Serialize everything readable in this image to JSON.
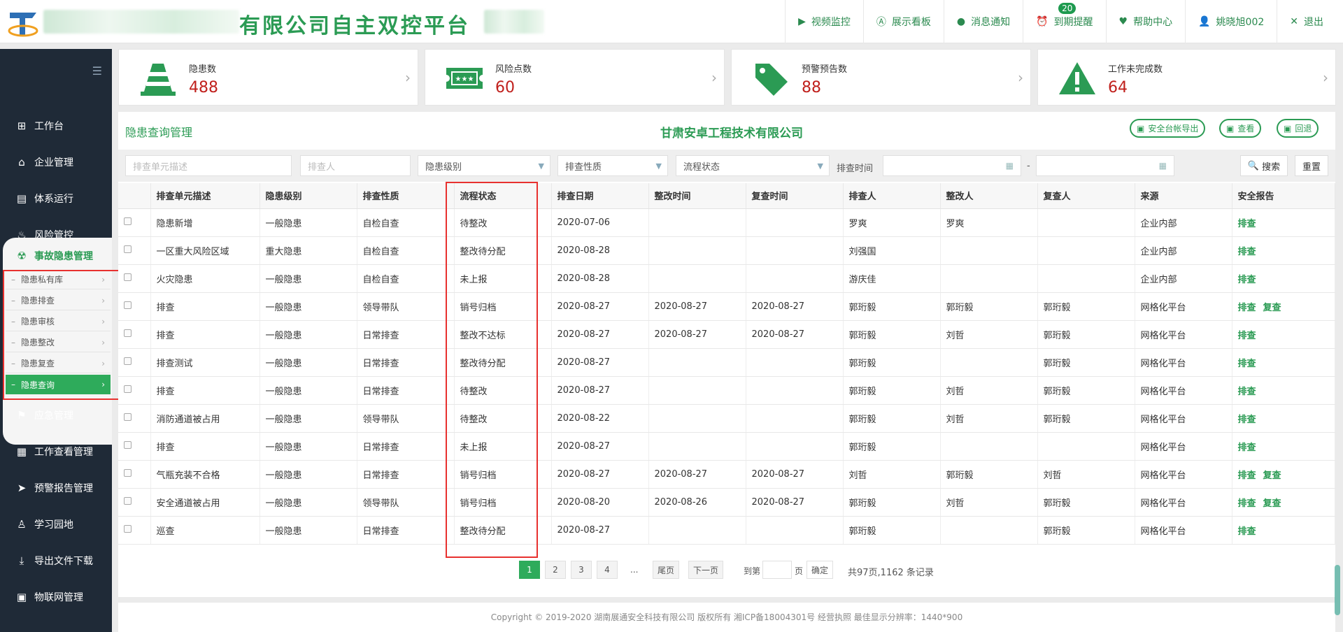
{
  "header": {
    "title_suffix": "有限公司自主双控平台",
    "nav": [
      {
        "label": "视频监控",
        "icon": "video-icon"
      },
      {
        "label": "展示看板",
        "icon": "board-icon"
      },
      {
        "label": "消息通知",
        "icon": "message-icon"
      },
      {
        "label": "到期提醒",
        "icon": "alarm-icon",
        "badge": "20"
      },
      {
        "label": "帮助中心",
        "icon": "heart-icon"
      },
      {
        "label": "姚晓旭002",
        "icon": "user-icon"
      },
      {
        "label": "退出",
        "icon": "close-icon"
      }
    ]
  },
  "sidebar": {
    "items": [
      {
        "label": "工作台",
        "icon": "windows-icon"
      },
      {
        "label": "企业管理",
        "icon": "home-icon"
      },
      {
        "label": "体系运行",
        "icon": "document-icon"
      },
      {
        "label": "风险管控",
        "icon": "fire-icon"
      },
      {
        "label": "事故隐患管理",
        "icon": "radiation-icon"
      },
      {
        "label": "应急管理",
        "icon": "emergency-icon"
      },
      {
        "label": "工作查看管理",
        "icon": "calendar-icon"
      },
      {
        "label": "预警报告管理",
        "icon": "send-icon"
      },
      {
        "label": "学习园地",
        "icon": "learn-icon"
      },
      {
        "label": "导出文件下载",
        "icon": "download-icon"
      },
      {
        "label": "物联网管理",
        "icon": "iot-icon"
      }
    ],
    "sub_items": [
      "隐患私有库",
      "隐患排查",
      "隐患审核",
      "隐患整改",
      "隐患复查",
      "隐患查询"
    ]
  },
  "stats": [
    {
      "label": "隐患数",
      "value": "488",
      "icon": "cone-icon"
    },
    {
      "label": "风险点数",
      "value": "60",
      "icon": "ticket-icon"
    },
    {
      "label": "预警预告数",
      "value": "88",
      "icon": "tag-icon"
    },
    {
      "label": "工作未完成数",
      "value": "64",
      "icon": "warning-icon"
    }
  ],
  "panel": {
    "title": "隐患查询管理",
    "company": "甘肃安卓工程技术有限公司",
    "buttons": [
      "安全台帐导出",
      "查看",
      "回退"
    ]
  },
  "filters": {
    "unit_placeholder": "排查单元描述",
    "person_placeholder": "排查人",
    "level": "隐患级别",
    "nature": "排查性质",
    "status": "流程状态",
    "time_label": "排查时间",
    "dash": "-",
    "search": "搜索",
    "reset": "重置"
  },
  "table": {
    "headers": [
      "排查单元描述",
      "隐患级别",
      "排查性质",
      "流程状态",
      "排查日期",
      "整改时间",
      "复查时间",
      "排查人",
      "整改人",
      "复查人",
      "来源",
      "安全报告"
    ],
    "rows": [
      {
        "c": [
          "隐患新增",
          "一般隐患",
          "自检自查",
          "待整改",
          "2020-07-06",
          "",
          "",
          "罗爽",
          "罗爽",
          "",
          "企业内部"
        ],
        "links": [
          "排查"
        ]
      },
      {
        "c": [
          "一区重大风险区域",
          "重大隐患",
          "自检自查",
          "整改待分配",
          "2020-08-28",
          "",
          "",
          "刘强国",
          "",
          "",
          "企业内部"
        ],
        "links": [
          "排查"
        ]
      },
      {
        "c": [
          "火灾隐患",
          "一般隐患",
          "自检自查",
          "未上报",
          "2020-08-28",
          "",
          "",
          "游庆佳",
          "",
          "",
          "企业内部"
        ],
        "links": [
          "排查"
        ]
      },
      {
        "c": [
          "排查",
          "一般隐患",
          "领导带队",
          "销号归档",
          "2020-08-27",
          "2020-08-27",
          "2020-08-27",
          "郭珩毅",
          "郭珩毅",
          "郭珩毅",
          "网格化平台"
        ],
        "links": [
          "排查",
          "复查"
        ]
      },
      {
        "c": [
          "排查",
          "一般隐患",
          "日常排查",
          "整改不达标",
          "2020-08-27",
          "2020-08-27",
          "2020-08-27",
          "郭珩毅",
          "刘哲",
          "郭珩毅",
          "网格化平台"
        ],
        "links": [
          "排查"
        ]
      },
      {
        "c": [
          "排查测试",
          "一般隐患",
          "日常排查",
          "整改待分配",
          "2020-08-27",
          "",
          "",
          "郭珩毅",
          "",
          "郭珩毅",
          "网格化平台"
        ],
        "links": [
          "排查"
        ]
      },
      {
        "c": [
          "排查",
          "一般隐患",
          "日常排查",
          "待整改",
          "2020-08-27",
          "",
          "",
          "郭珩毅",
          "刘哲",
          "郭珩毅",
          "网格化平台"
        ],
        "links": [
          "排查"
        ]
      },
      {
        "c": [
          "消防通道被占用",
          "一般隐患",
          "领导带队",
          "待整改",
          "2020-08-22",
          "",
          "",
          "郭珩毅",
          "刘哲",
          "郭珩毅",
          "网格化平台"
        ],
        "links": [
          "排查"
        ]
      },
      {
        "c": [
          "排查",
          "一般隐患",
          "日常排查",
          "未上报",
          "2020-08-27",
          "",
          "",
          "郭珩毅",
          "",
          "",
          "网格化平台"
        ],
        "links": [
          "排查"
        ]
      },
      {
        "c": [
          "气瓶充装不合格",
          "一般隐患",
          "日常排查",
          "销号归档",
          "2020-08-27",
          "2020-08-27",
          "2020-08-27",
          "刘哲",
          "郭珩毅",
          "刘哲",
          "网格化平台"
        ],
        "links": [
          "排查",
          "复查"
        ]
      },
      {
        "c": [
          "安全通道被占用",
          "一般隐患",
          "领导带队",
          "销号归档",
          "2020-08-20",
          "2020-08-26",
          "2020-08-27",
          "郭珩毅",
          "刘哲",
          "郭珩毅",
          "网格化平台"
        ],
        "links": [
          "排查",
          "复查"
        ]
      },
      {
        "c": [
          "巡查",
          "一般隐患",
          "日常排查",
          "整改待分配",
          "2020-08-27",
          "",
          "",
          "郭珩毅",
          "",
          "郭珩毅",
          "网格化平台"
        ],
        "links": [
          "排查"
        ]
      }
    ]
  },
  "pager": {
    "pages": [
      "1",
      "2",
      "3",
      "4"
    ],
    "ellipsis": "...",
    "last": "尾页",
    "next": "下一页",
    "goto": "到第",
    "page_unit": "页",
    "confirm": "确定",
    "summary": "共97页,1162 条记录"
  },
  "footer": "Copyright © 2019-2020 湖南展通安全科技有限公司 版权所有 湘ICP备18004301号 经营执照   最佳显示分辨率：1440*900",
  "colors": {
    "accent": "#2b9b54",
    "stat_value": "#c0201c",
    "sidebar_bg": "#1f2a37",
    "highlight_box": "#e8312f"
  }
}
